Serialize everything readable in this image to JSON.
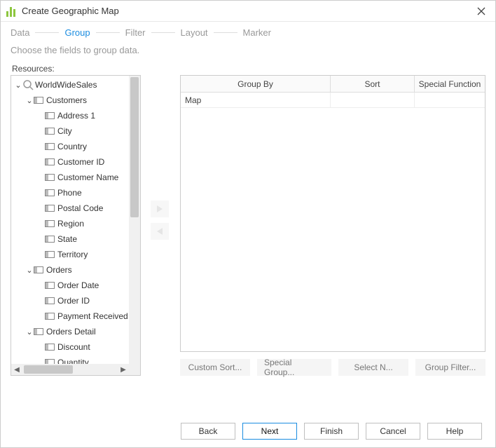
{
  "title": "Create Geographic Map",
  "steps": [
    "Data",
    "Group",
    "Filter",
    "Layout",
    "Marker"
  ],
  "active_step_index": 1,
  "subtitle": "Choose the fields to group data.",
  "resources_label": "Resources:",
  "tree": {
    "root": "WorldWideSales",
    "groups": [
      {
        "name": "Customers",
        "fields": [
          "Address 1",
          "City",
          "Country",
          "Customer ID",
          "Customer Name",
          "Phone",
          "Postal Code",
          "Region",
          "State",
          "Territory"
        ]
      },
      {
        "name": "Orders",
        "fields": [
          "Order Date",
          "Order ID",
          "Payment Received"
        ]
      },
      {
        "name": "Orders Detail",
        "fields": [
          "Discount",
          "Quantity"
        ]
      }
    ]
  },
  "grid": {
    "headers": {
      "groupby": "Group By",
      "sort": "Sort",
      "func": "Special Function"
    },
    "rows": [
      {
        "groupby": "Map",
        "sort": "",
        "func": ""
      }
    ]
  },
  "action_buttons": {
    "custom_sort": "Custom Sort...",
    "special_group": "Special Group...",
    "select_n": "Select N...",
    "group_filter": "Group Filter..."
  },
  "footer_buttons": {
    "back": "Back",
    "next": "Next",
    "finish": "Finish",
    "cancel": "Cancel",
    "help": "Help"
  }
}
